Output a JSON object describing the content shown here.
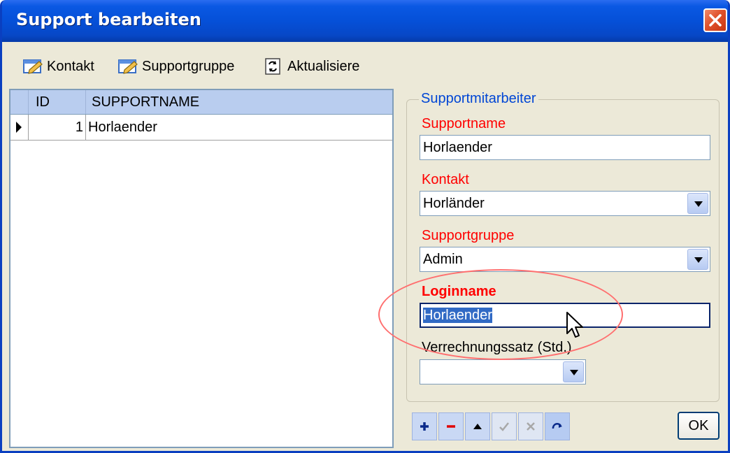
{
  "window": {
    "title": "Support bearbeiten"
  },
  "toolbar": {
    "items": [
      {
        "label": "Kontakt",
        "icon": "edit-icon"
      },
      {
        "label": "Supportgruppe",
        "icon": "edit-icon"
      },
      {
        "label": "Aktualisiere",
        "icon": "refresh-icon"
      }
    ]
  },
  "grid": {
    "columns": [
      "ID",
      "SUPPORTNAME"
    ],
    "rows": [
      {
        "id": "1",
        "name": "Horlaender",
        "current": true
      }
    ]
  },
  "form": {
    "group_title": "Supportmitarbeiter",
    "supportname": {
      "label": "Supportname",
      "value": "Horlaender"
    },
    "kontakt": {
      "label": "Kontakt",
      "value": "Horländer"
    },
    "supportgruppe": {
      "label": "Supportgruppe",
      "value": "Admin"
    },
    "loginname": {
      "label": "Loginname",
      "value": "Horlaender"
    },
    "verrechnungssatz": {
      "label": "Verrechnungssatz (Std.)",
      "value": ""
    }
  },
  "navigator": {
    "buttons": [
      {
        "name": "add-record-button",
        "icon": "plus-icon",
        "enabled": true
      },
      {
        "name": "delete-record-button",
        "icon": "minus-icon",
        "enabled": true
      },
      {
        "name": "edit-record-button",
        "icon": "up-arrow-icon",
        "enabled": true
      },
      {
        "name": "post-record-button",
        "icon": "check-icon",
        "enabled": false
      },
      {
        "name": "cancel-record-button",
        "icon": "x-icon",
        "enabled": false
      },
      {
        "name": "refresh-record-button",
        "icon": "refresh-icon",
        "enabled": true
      }
    ]
  },
  "ok_button": {
    "label": "OK"
  },
  "colors": {
    "title_bar": "#0550d8",
    "required_label": "#ff0000",
    "group_title": "#0046d5",
    "selection": "#316ac5",
    "annotation_ellipse": "#ff6f6f"
  }
}
